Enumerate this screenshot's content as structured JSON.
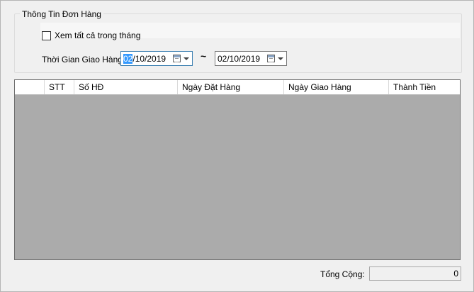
{
  "order_info": {
    "group_title": "Thông Tin Đơn Hàng",
    "view_all_label": "Xem tất cả trong tháng",
    "view_all_checked": false,
    "delivery_time_label": "Thời Gian Giao Hàng",
    "date_from": {
      "selected_part": "02",
      "rest": "/10/2019"
    },
    "date_to": "02/10/2019",
    "range_separator": "~"
  },
  "grid": {
    "columns": [
      "STT",
      "Số HĐ",
      "Ngày Đặt Hàng",
      "Ngày Giao Hàng",
      "Thành Tiền"
    ],
    "rows": [],
    "background_color": "#ababab"
  },
  "footer": {
    "total_label": "Tổng Cộng:",
    "total_value": "0"
  },
  "colors": {
    "window_bg": "#f0f0f0",
    "selection": "#3399ff"
  }
}
